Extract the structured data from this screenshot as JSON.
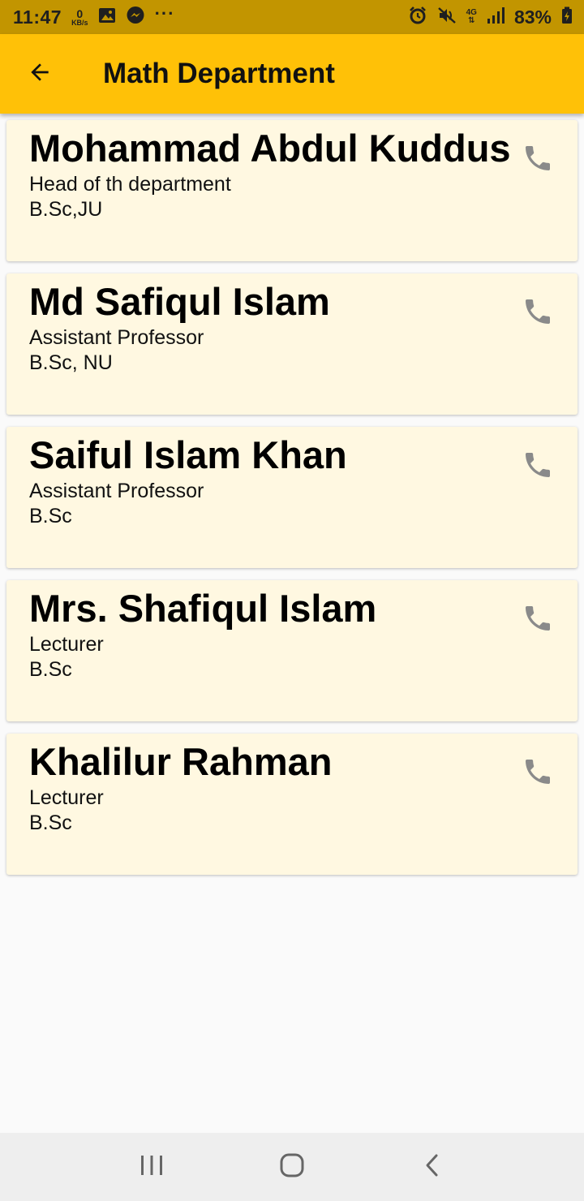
{
  "status_bar": {
    "time": "11:47",
    "net_speed_value": "0",
    "net_speed_unit": "KB/s",
    "more_indicator": "···",
    "network_type": "4G",
    "battery": "83%"
  },
  "app_bar": {
    "title": "Math Department"
  },
  "teachers": [
    {
      "name": "Mohammad Abdul Kuddus",
      "designation": "Head of th department",
      "qualification": "B.Sc,JU"
    },
    {
      "name": "Md Safiqul Islam",
      "designation": "Assistant Professor",
      "qualification": "B.Sc, NU"
    },
    {
      "name": "Saiful Islam Khan",
      "designation": "Assistant Professor",
      "qualification": "B.Sc"
    },
    {
      "name": "Mrs. Shafiqul Islam",
      "designation": "Lecturer",
      "qualification": "B.Sc"
    },
    {
      "name": "Khalilur Rahman",
      "designation": "Lecturer",
      "qualification": "B.Sc"
    }
  ],
  "icons": {
    "back": "arrow-back-icon",
    "call": "phone-icon",
    "recents": "recent-apps-icon",
    "home": "home-icon",
    "nav_back": "chevron-left-icon"
  },
  "colors": {
    "status_bar": "#c29500",
    "app_bar": "#ffc107",
    "card": "#fff8e1",
    "phone_icon": "#8a8a8a"
  }
}
